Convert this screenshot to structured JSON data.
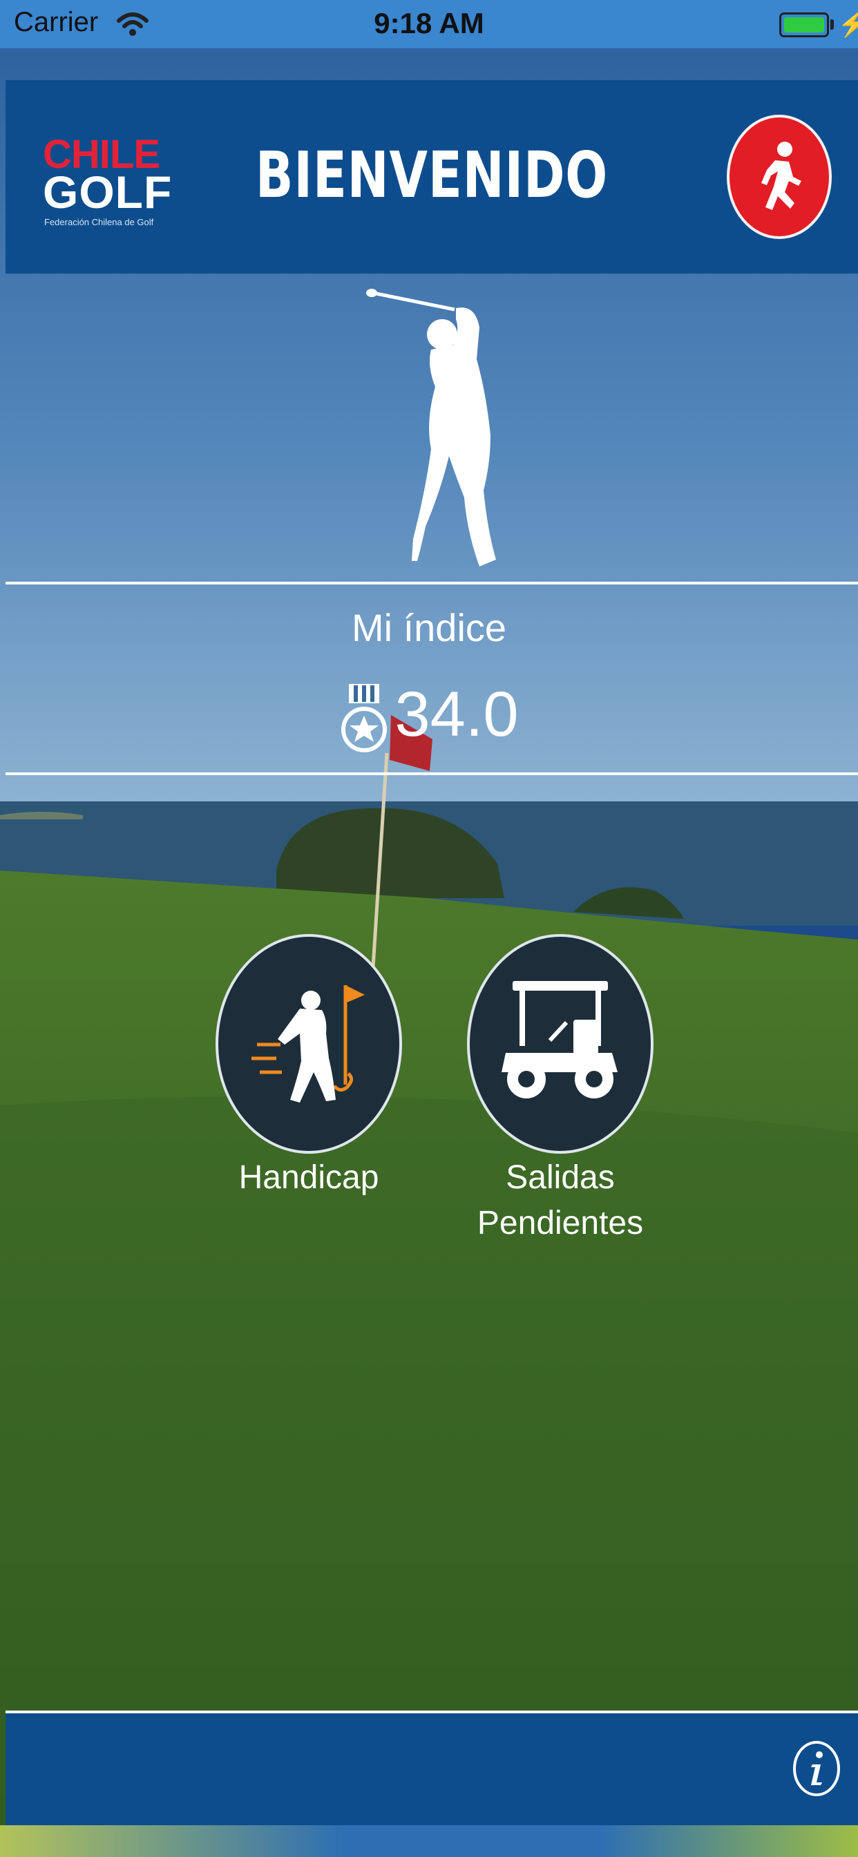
{
  "status_bar": {
    "carrier": "Carrier",
    "time": "9:18 AM"
  },
  "header": {
    "logo": {
      "line1": "CHILE",
      "line2": "GOLF",
      "tagline": "Federación Chilena de Golf"
    },
    "title": "BIENVENIDO",
    "logout_icon": "running-person-icon"
  },
  "index": {
    "label": "Mi índice",
    "value": "34.0",
    "icon": "medal-icon"
  },
  "menu": [
    {
      "label": "Handicap",
      "icon": "golfer-flag-icon"
    },
    {
      "label_line1": "Salidas",
      "label_line2": "Pendientes",
      "icon": "golf-cart-icon"
    }
  ],
  "footer": {
    "info_icon": "info-icon"
  },
  "colors": {
    "header_bg": "#0d4d8d",
    "logout_red": "#e31d25",
    "logo_red": "#e3223a",
    "status_bar": "#3a86cf",
    "accent_orange": "#f08a1c"
  }
}
